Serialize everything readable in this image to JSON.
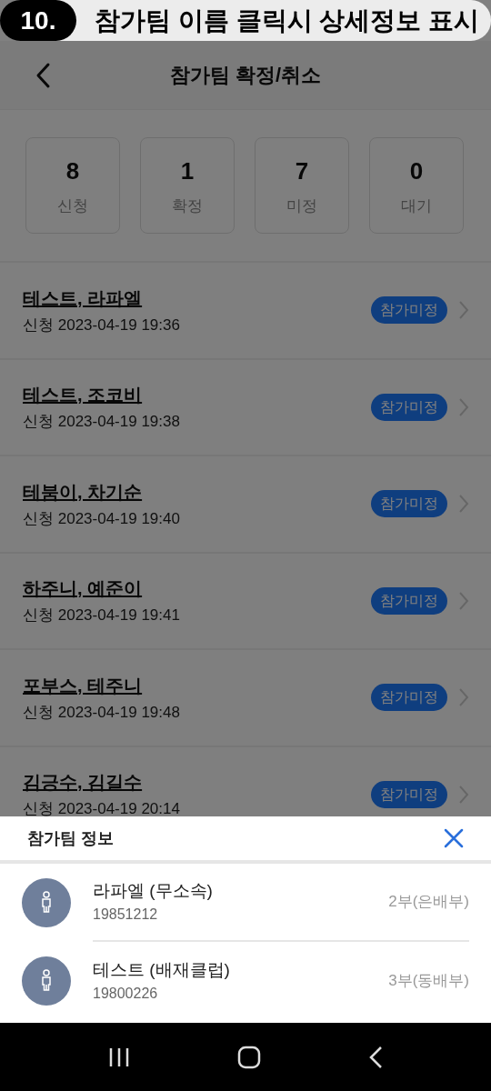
{
  "banner": {
    "number": "10.",
    "title": "참가팀 이름 클릭시 상세정보 표시"
  },
  "header": {
    "title": "참가팀 확정/취소"
  },
  "stats": [
    {
      "value": "8",
      "label": "신청"
    },
    {
      "value": "1",
      "label": "확정"
    },
    {
      "value": "7",
      "label": "미정"
    },
    {
      "value": "0",
      "label": "대기"
    }
  ],
  "teams": [
    {
      "name": "테스트, 라파엘",
      "applied": "신청 2023-04-19 19:36",
      "status": "참가미정"
    },
    {
      "name": "테스트, 조코비",
      "applied": "신청 2023-04-19 19:38",
      "status": "참가미정"
    },
    {
      "name": "테붐이, 차기순",
      "applied": "신청 2023-04-19 19:40",
      "status": "참가미정"
    },
    {
      "name": "하주니, 예준이",
      "applied": "신청 2023-04-19 19:41",
      "status": "참가미정"
    },
    {
      "name": "포부스, 테주니",
      "applied": "신청 2023-04-19 19:48",
      "status": "참가미정"
    },
    {
      "name": "김긍수, 김길수",
      "applied": "신청 2023-04-19 20:14",
      "status": "참가미정"
    }
  ],
  "sheet": {
    "title": "참가팀 정보",
    "members": [
      {
        "name": "라파엘 (무소속)",
        "birth": "19851212",
        "division": "2부(은배부)"
      },
      {
        "name": "테스트 (배재클럽)",
        "birth": "19800226",
        "division": "3부(동배부)"
      }
    ]
  }
}
